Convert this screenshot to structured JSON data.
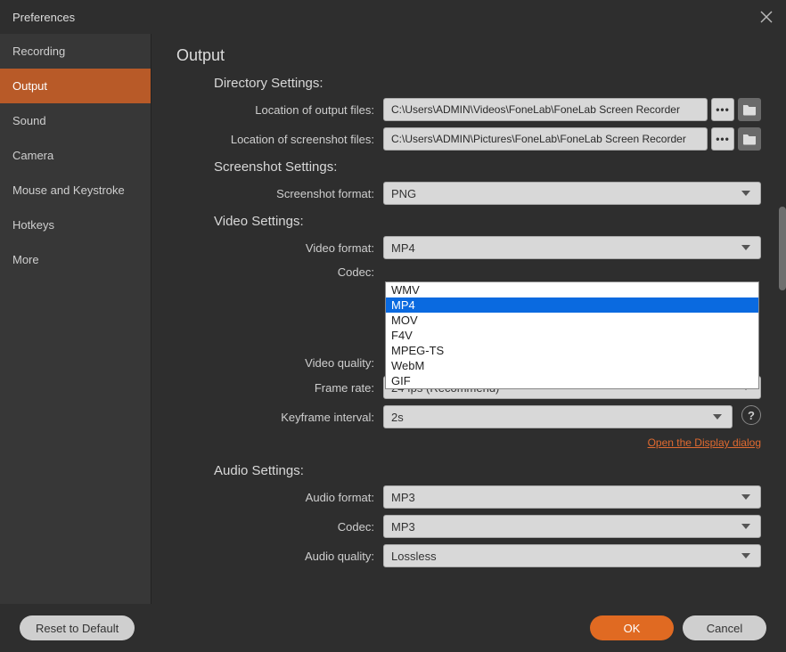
{
  "window": {
    "title": "Preferences"
  },
  "sidebar": {
    "items": [
      {
        "label": "Recording"
      },
      {
        "label": "Output"
      },
      {
        "label": "Sound"
      },
      {
        "label": "Camera"
      },
      {
        "label": "Mouse and Keystroke"
      },
      {
        "label": "Hotkeys"
      },
      {
        "label": "More"
      }
    ],
    "active_index": 1
  },
  "page": {
    "title": "Output",
    "directory_section": "Directory Settings:",
    "screenshot_section": "Screenshot Settings:",
    "video_section": "Video Settings:",
    "audio_section": "Audio Settings:",
    "labels": {
      "output_location": "Location of output files:",
      "screenshot_location": "Location of screenshot files:",
      "screenshot_format": "Screenshot format:",
      "video_format": "Video format:",
      "codec": "Codec:",
      "video_quality": "Video quality:",
      "frame_rate": "Frame rate:",
      "keyframe_interval": "Keyframe interval:",
      "audio_format": "Audio format:",
      "audio_codec": "Codec:",
      "audio_quality": "Audio quality:"
    },
    "values": {
      "output_location": "C:\\Users\\ADMIN\\Videos\\FoneLab\\FoneLab Screen Recorder",
      "screenshot_location": "C:\\Users\\ADMIN\\Pictures\\FoneLab\\FoneLab Screen Recorder",
      "screenshot_format": "PNG",
      "video_format": "MP4",
      "frame_rate": "24 fps (Recommend)",
      "keyframe_interval": "2s",
      "audio_format": "MP3",
      "audio_codec": "MP3",
      "audio_quality": "Lossless"
    },
    "video_format_options": [
      "WMV",
      "MP4",
      "MOV",
      "F4V",
      "MPEG-TS",
      "WebM",
      "GIF"
    ],
    "video_format_selected": "MP4",
    "display_link": "Open the Display dialog"
  },
  "footer": {
    "reset": "Reset to Default",
    "ok": "OK",
    "cancel": "Cancel"
  }
}
